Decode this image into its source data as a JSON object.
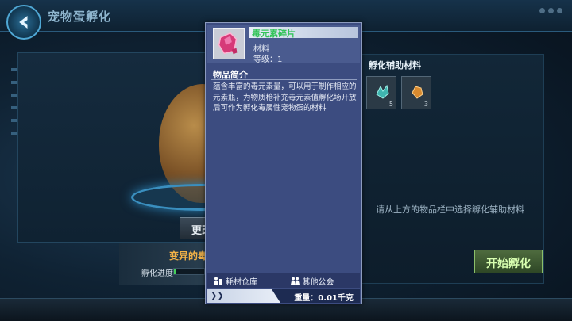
{
  "header": {
    "title": "宠物蛋孵化",
    "back_icon": "back-arrow-icon"
  },
  "main": {
    "change_button_label": "更改",
    "mutant_text": "变异的毒",
    "progress_label": "孵化进度",
    "progress_value": 0.05
  },
  "aux_panel": {
    "title": "孵化辅助材料",
    "slots": [
      {
        "icon": "teal-crystal-icon",
        "count": "5",
        "color": "#3fb5b0"
      },
      {
        "icon": "orange-crystal-icon",
        "count": "3",
        "color": "#d88a2f"
      }
    ],
    "hint": "请从上方的物品栏中选择孵化辅助材料",
    "start_button_label": "开始孵化"
  },
  "tooltip": {
    "item_name": "毒元素碎片",
    "item_name_color": "#34c45a",
    "item_type": "材料",
    "item_level": "等级：1",
    "section_title": "物品简介",
    "description": "蕴含丰富的毒元素量，可以用于制作相应的元素瓶，为物质枪补充毒元素值孵化场开放后可作为孵化毒属性宠物蛋的材料",
    "sources": [
      {
        "icon": "warehouse-icon",
        "label": "耗材仓库"
      },
      {
        "icon": "guild-icon",
        "label": "其他公会"
      }
    ],
    "weight": "重量：0.01千克"
  }
}
